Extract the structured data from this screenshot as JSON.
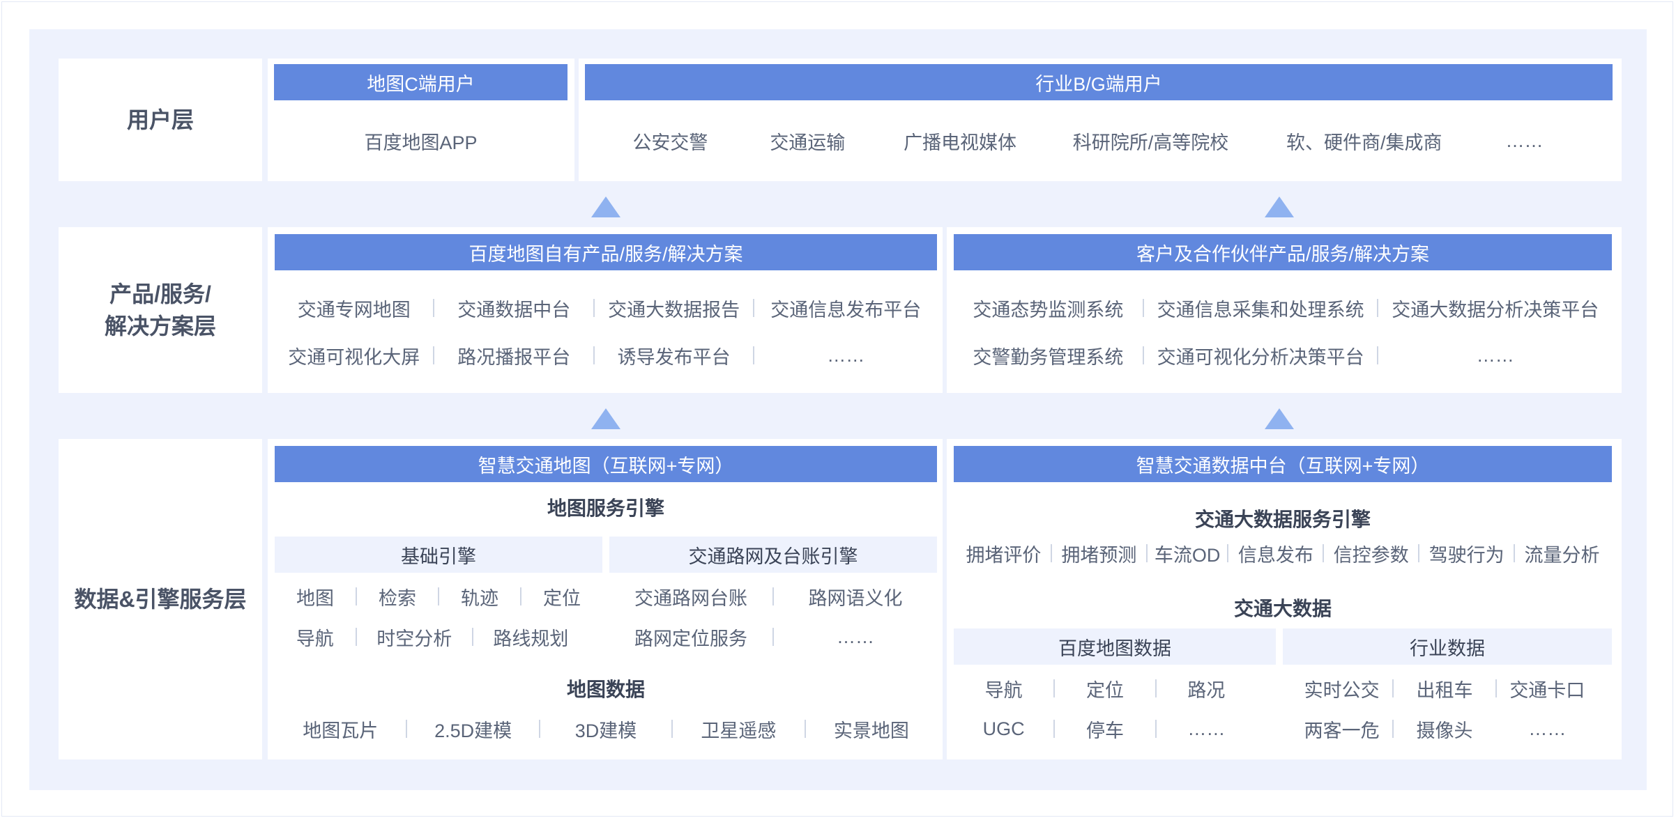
{
  "colors": {
    "canvas": "#eef2fd",
    "header": "#6188de",
    "arrow": "#8fb2f0",
    "label": "#4a5366",
    "text": "#5a6478"
  },
  "user_layer": {
    "label": "用户层",
    "c_header": "地图C端用户",
    "c_item": "百度地图APP",
    "bg_header": "行业B/G端用户",
    "bg_items": [
      "公安交警",
      "交通运输",
      "广播电视媒体",
      "科研院所/高等院校",
      "软、硬件商/集成商",
      "……"
    ]
  },
  "product_layer": {
    "label_line1": "产品/服务/",
    "label_line2": "解决方案层",
    "left_header": "百度地图自有产品/服务/解决方案",
    "left_row1": [
      "交通专网地图",
      "交通数据中台",
      "交通大数据报告",
      "交通信息发布平台"
    ],
    "left_row2": [
      "交通可视化大屏",
      "路况播报平台",
      "诱导发布平台",
      "……"
    ],
    "right_header": "客户及合作伙伴产品/服务/解决方案",
    "right_row1": [
      "交通态势监测系统",
      "交通信息采集和处理系统",
      "交通大数据分析决策平台"
    ],
    "right_row2": [
      "交警勤务管理系统",
      "交通可视化分析决策平台",
      "……"
    ]
  },
  "data_layer": {
    "label": "数据&引擎服务层",
    "left": {
      "header": "智慧交通地图（互联网+专网）",
      "engine_title": "地图服务引擎",
      "basic_title": "基础引擎",
      "basic_row1": [
        "地图",
        "检索",
        "轨迹",
        "定位"
      ],
      "basic_row2": [
        "导航",
        "时空分析",
        "路线规划"
      ],
      "road_title": "交通路网及台账引擎",
      "road_row1": [
        "交通路网台账",
        "路网语义化"
      ],
      "road_row2": [
        "路网定位服务",
        "……"
      ],
      "map_data_title": "地图数据",
      "map_data_row": [
        "地图瓦片",
        "2.5D建模",
        "3D建模",
        "卫星遥感",
        "实景地图"
      ]
    },
    "right": {
      "header": "智慧交通数据中台（互联网+专网）",
      "engine_title": "交通大数据服务引擎",
      "engine_row": [
        "拥堵评价",
        "拥堵预测",
        "车流OD",
        "信息发布",
        "信控参数",
        "驾驶行为",
        "流量分析"
      ],
      "big_data_title": "交通大数据",
      "baidu_title": "百度地图数据",
      "baidu_row1": [
        "导航",
        "定位",
        "路况"
      ],
      "baidu_row2": [
        "UGC",
        "停车",
        "……"
      ],
      "industry_title": "行业数据",
      "industry_row1": [
        "实时公交",
        "出租车",
        "交通卡口"
      ],
      "industry_row2": [
        "两客一危",
        "摄像头",
        "……"
      ]
    }
  }
}
